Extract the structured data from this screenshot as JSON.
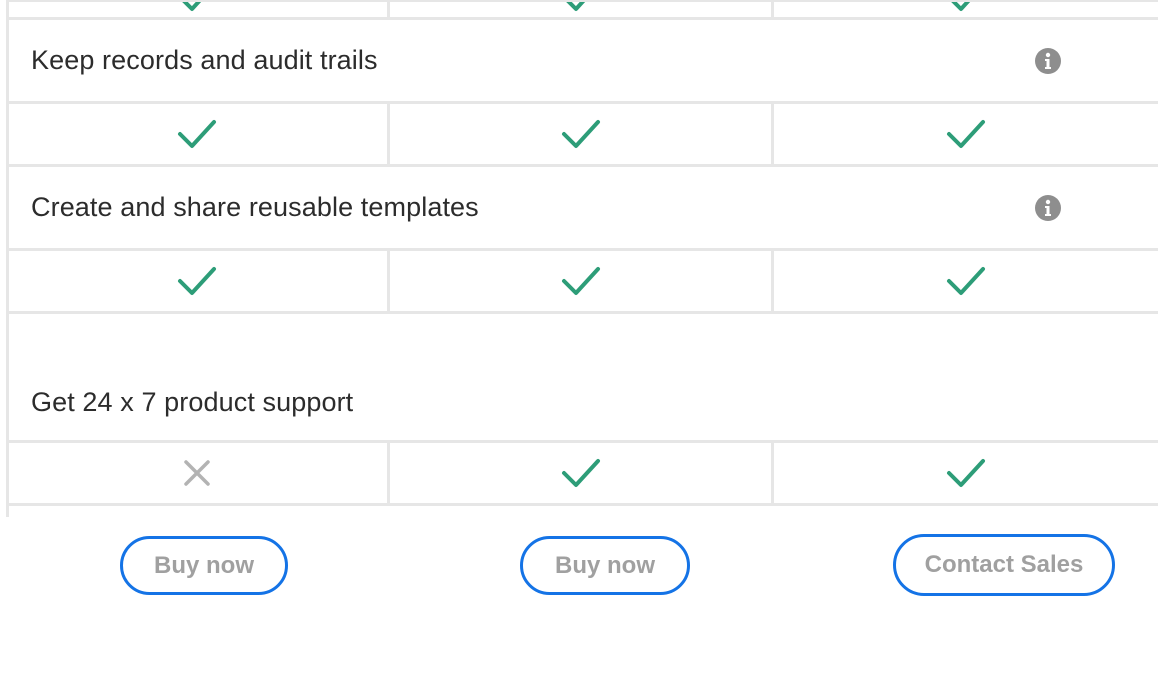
{
  "features": [
    {
      "label": "Keep records and audit trails",
      "has_info": true,
      "marks": [
        "check",
        "check",
        "check"
      ]
    },
    {
      "label": "Create and share reusable templates",
      "has_info": true,
      "marks": [
        "check",
        "check",
        "check"
      ]
    },
    {
      "label": "Get 24 x 7 product support",
      "has_info": false,
      "marks": [
        "cross",
        "check",
        "check"
      ]
    }
  ],
  "top_marks": [
    "check",
    "check",
    "check"
  ],
  "buttons": {
    "plan1": "Buy now",
    "plan2": "Buy now",
    "plan3": "Contact Sales"
  },
  "colors": {
    "check": "#2d9d78",
    "cross": "#b3b3b3",
    "button_border": "#1473e6",
    "button_text": "#a0a0a0",
    "info_icon": "#8e8e8e",
    "divider": "#e6e6e6"
  }
}
